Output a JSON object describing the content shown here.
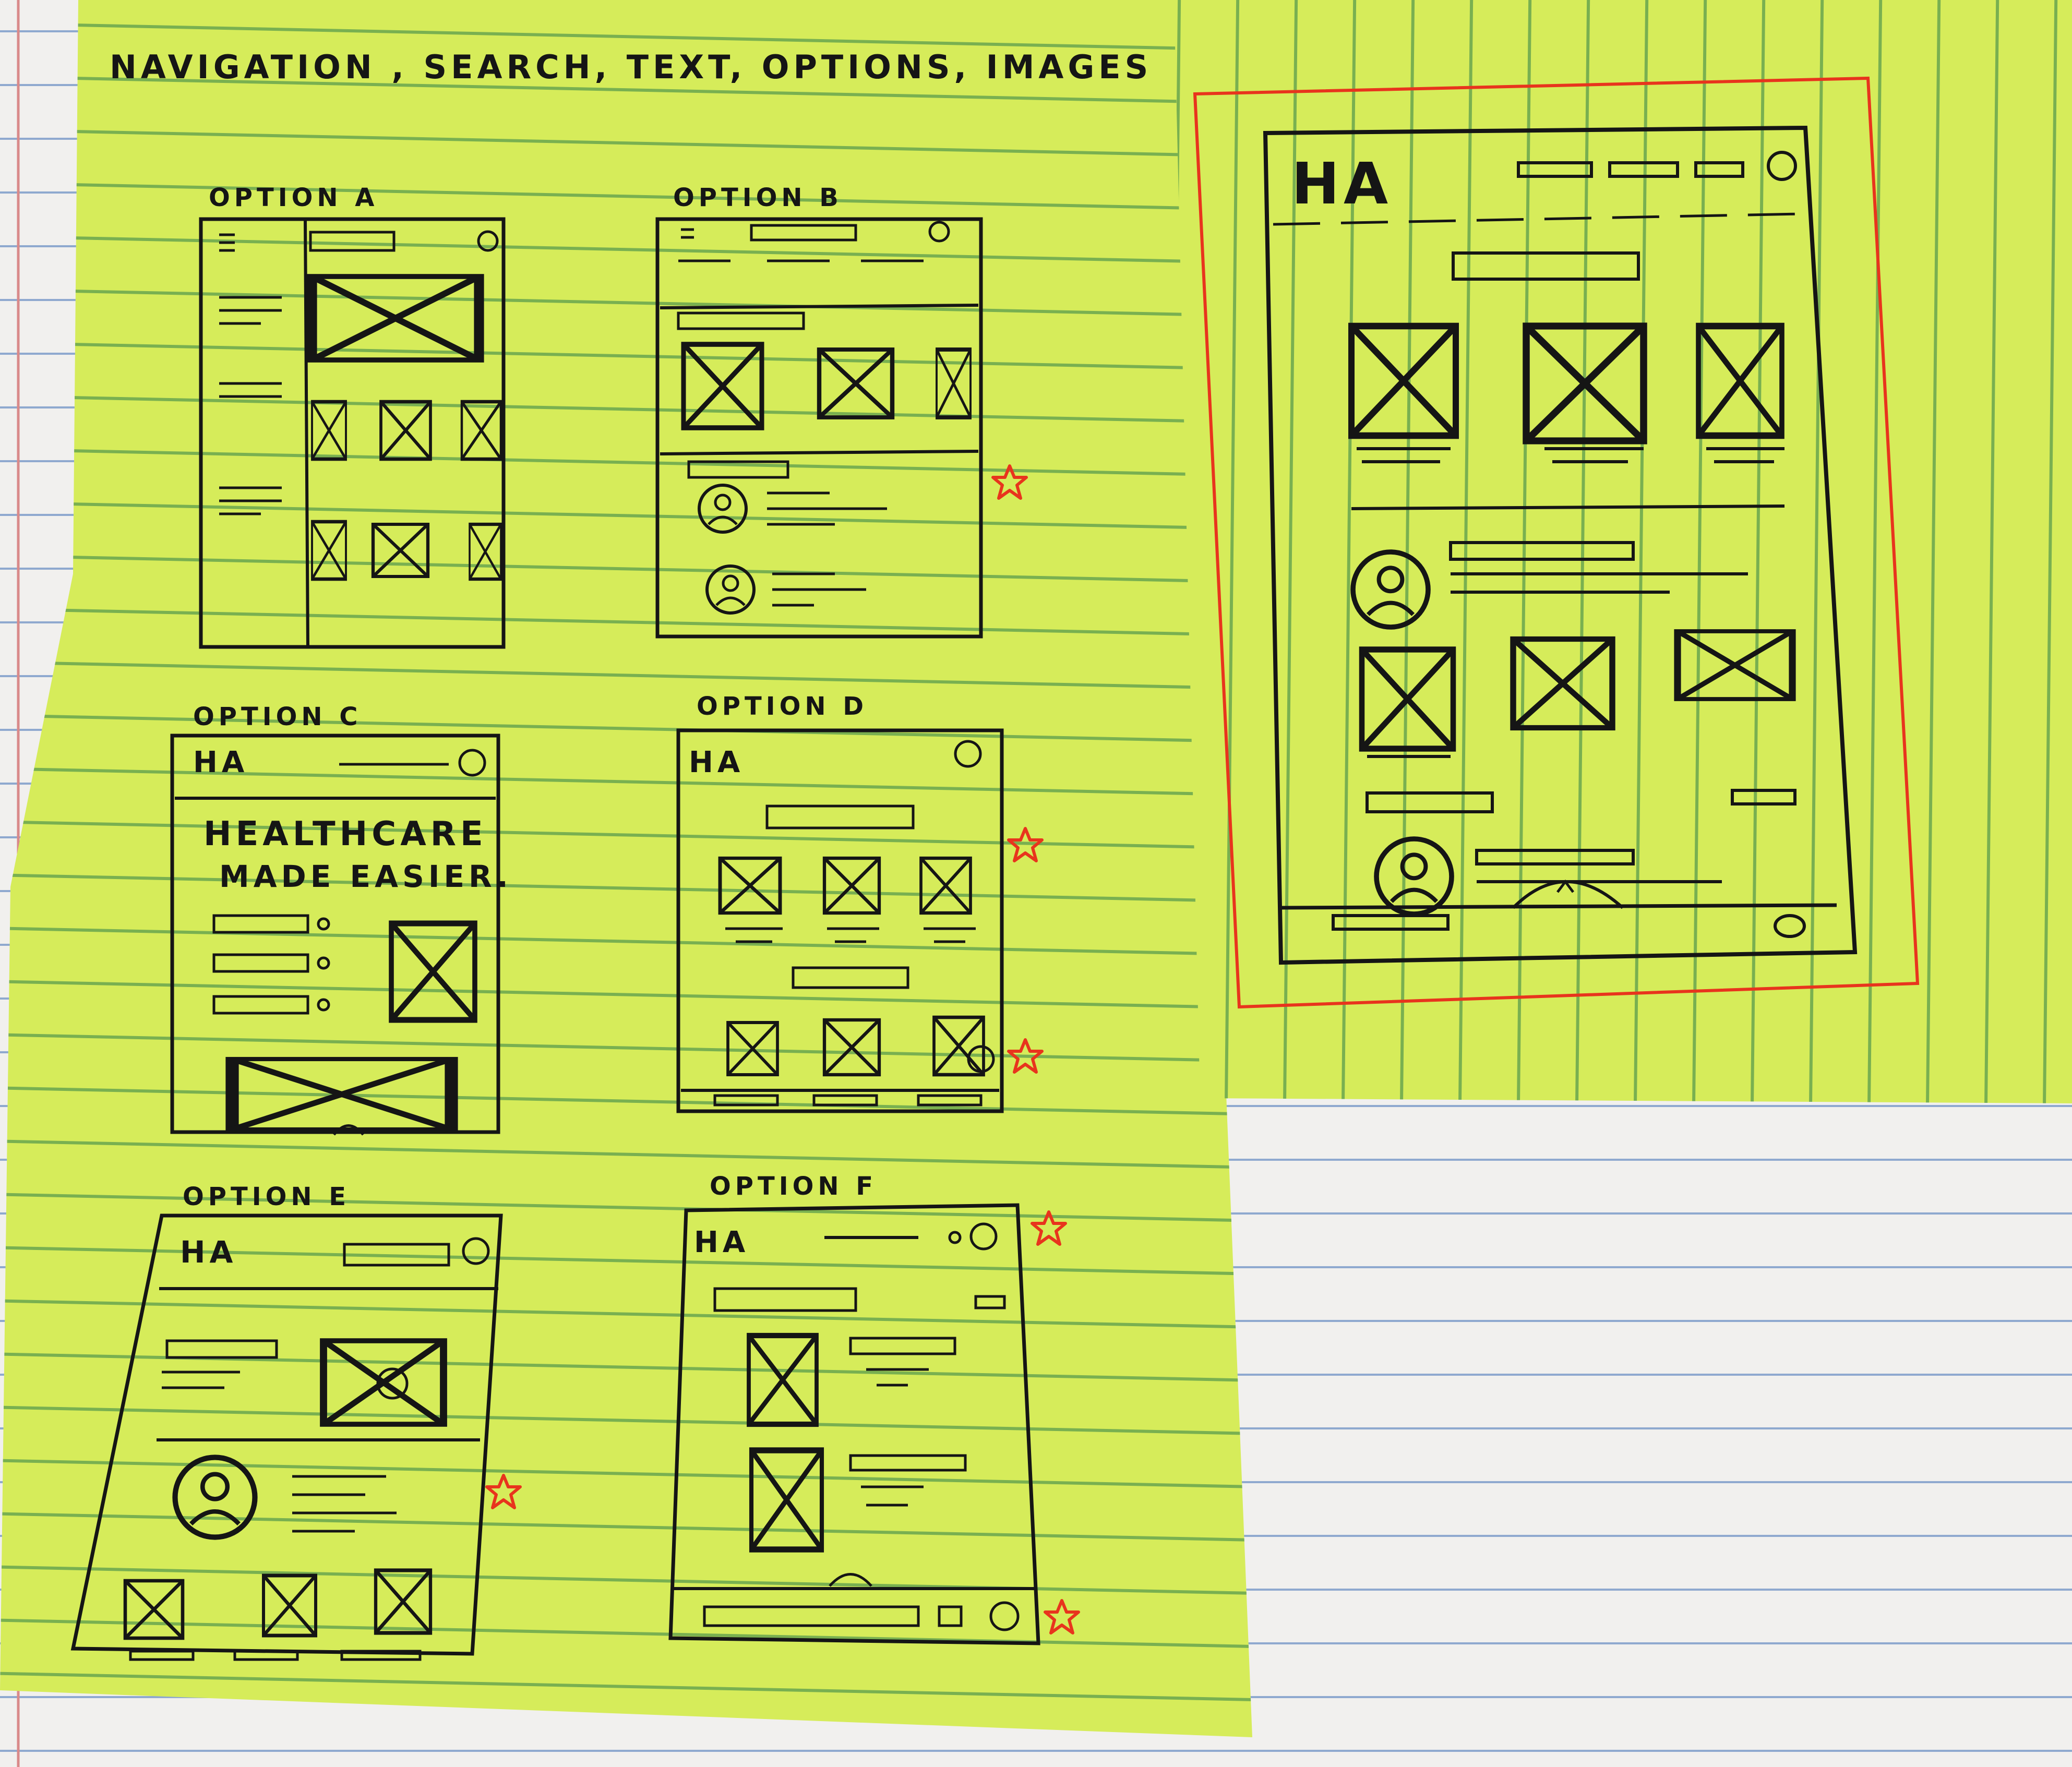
{
  "photo": {
    "paper_color": "#f1f0ee",
    "paper_rule_color": "#8fa9cf",
    "margin_line_color": "#d98a8a",
    "sticky_color": "#d6ec5a",
    "sticky_rule_color": "#7fb35a",
    "ink_color": "#151515",
    "star_color": "#e8341d"
  },
  "sheet": {
    "heading": "NAVIGATION , SEARCH, TEXT, OPTIONS, IMAGES"
  },
  "sketches": [
    {
      "label": "OPTION A",
      "starred": false
    },
    {
      "label": "OPTION B",
      "starred": true
    },
    {
      "label": "OPTION C",
      "starred": false,
      "hero_line_1": "HEALTHCARE",
      "hero_line_2": "MADE EASIER."
    },
    {
      "label": "OPTION D",
      "starred": true
    },
    {
      "label": "OPTION E",
      "starred": true
    },
    {
      "label": "OPTION F",
      "starred": true
    }
  ],
  "logo_text": "HA",
  "final_sketch": {
    "frame_color": "#e8341d"
  }
}
